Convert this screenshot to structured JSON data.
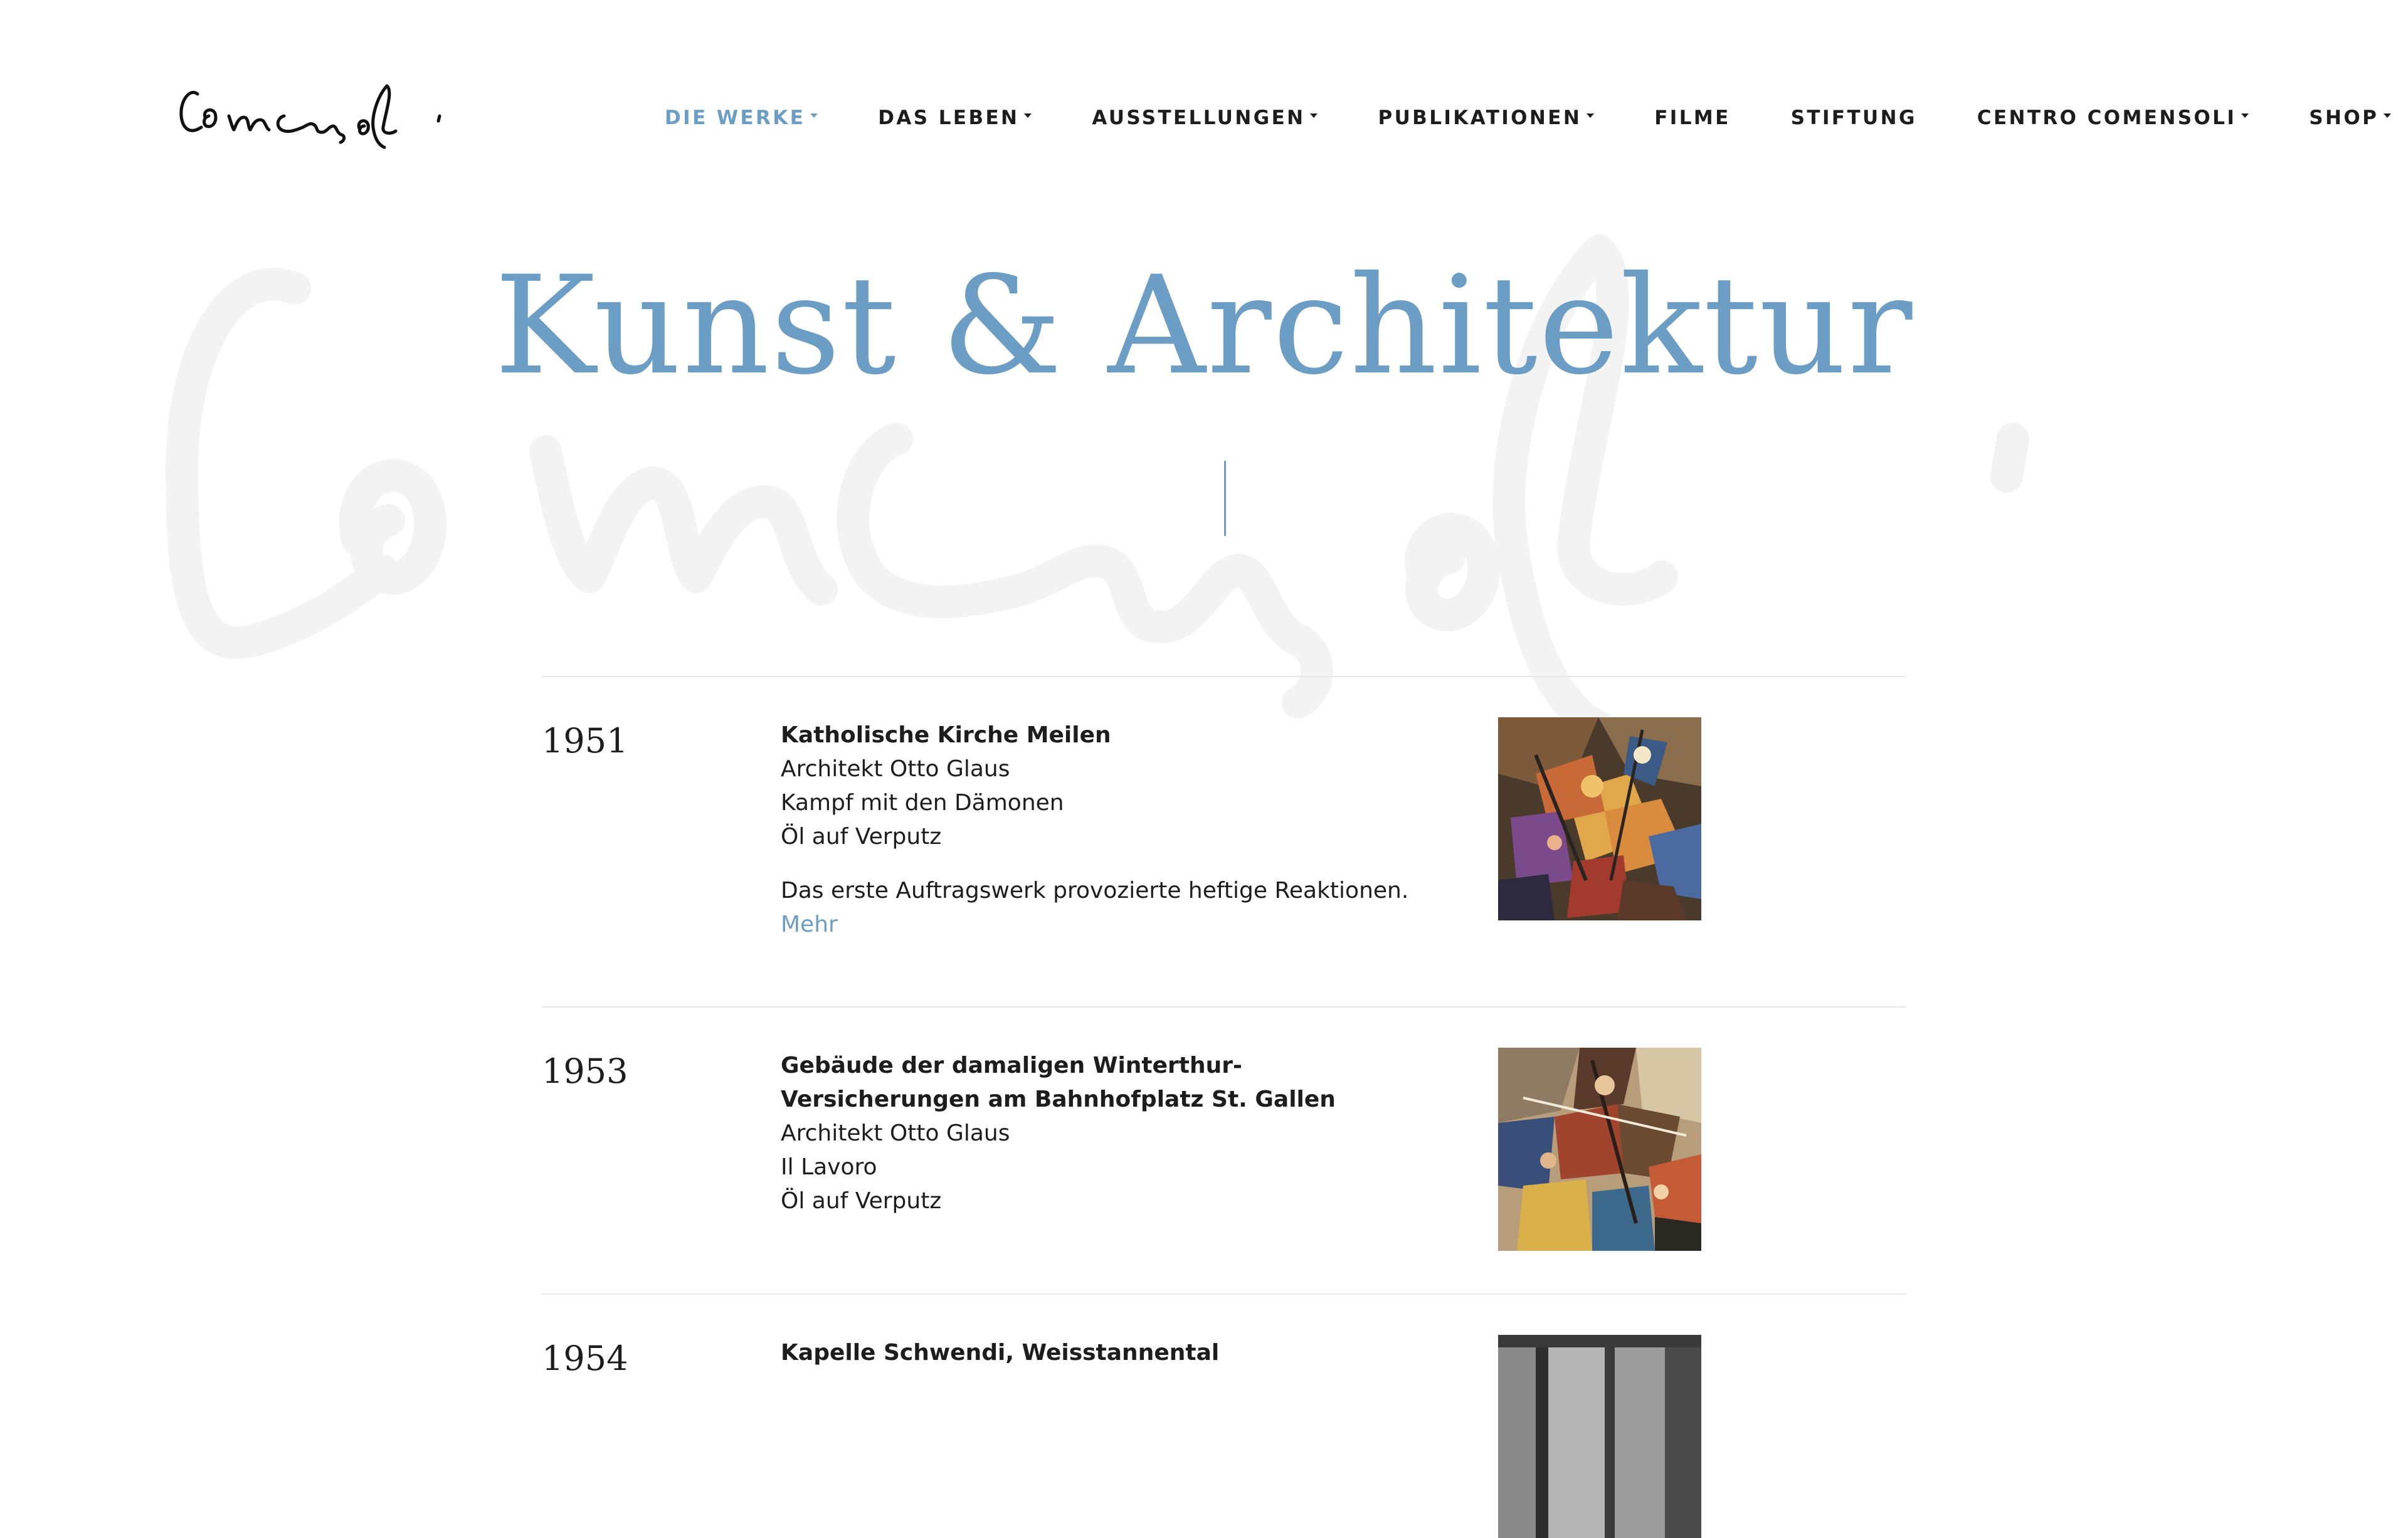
{
  "brand": {
    "logo_text": "Comensoli"
  },
  "nav": {
    "items": [
      {
        "label": "DIE WERKE",
        "dropdown": true,
        "active": true
      },
      {
        "label": "DAS LEBEN",
        "dropdown": true,
        "active": false
      },
      {
        "label": "AUSSTELLUNGEN",
        "dropdown": true,
        "active": false
      },
      {
        "label": "PUBLIKATIONEN",
        "dropdown": true,
        "active": false
      },
      {
        "label": "FILME",
        "dropdown": false,
        "active": false
      },
      {
        "label": "STIFTUNG",
        "dropdown": false,
        "active": false
      },
      {
        "label": "CENTRO COMENSOLI",
        "dropdown": true,
        "active": false
      },
      {
        "label": "SHOP",
        "dropdown": true,
        "active": false
      }
    ]
  },
  "hero": {
    "title": "Kunst & Architektur"
  },
  "works": [
    {
      "year": "1951",
      "title": "Katholische Kirche Meilen",
      "architect": "Architekt Otto Glaus",
      "name": "Kampf mit den Dämonen",
      "medium": "Öl auf Verputz",
      "description": "Das erste Auftragswerk provozierte heftige Reaktionen.",
      "more_label": "Mehr",
      "thumb_icon": "mural-painting-image"
    },
    {
      "year": "1953",
      "title": "Gebäude der damaligen Winterthur-Versicherungen am Bahnhofplatz St. Gallen",
      "architect": "Architekt Otto Glaus",
      "name": "Il Lavoro",
      "medium": "Öl auf Verputz",
      "thumb_icon": "mural-painting-image"
    },
    {
      "year": "1954",
      "title": "Kapelle Schwendi, Weisstannental",
      "thumb_icon": "chapel-photo-image"
    }
  ],
  "colors": {
    "accent": "#6b9dc5",
    "text": "#1d1d1d",
    "divider": "#e6e6e6",
    "watermark": "#f4f4f4"
  }
}
